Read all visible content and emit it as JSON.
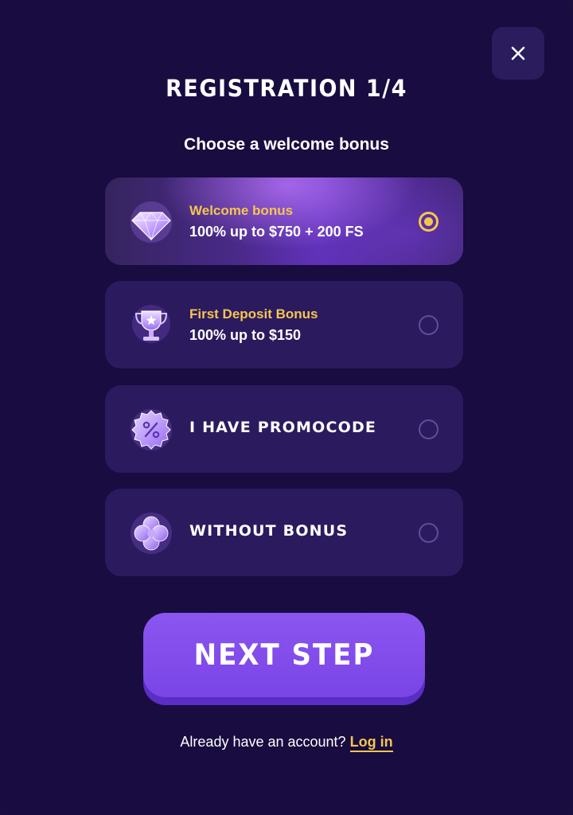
{
  "header": {
    "title": "REGISTRATION 1/4",
    "subtitle": "Choose a welcome bonus",
    "close_icon": "close-icon"
  },
  "options": [
    {
      "label": "Welcome bonus",
      "value": "100% up to $750 + 200 FS",
      "icon": "diamond-icon",
      "selected": true
    },
    {
      "label": "First Deposit Bonus",
      "value": "100% up to $150",
      "icon": "trophy-icon",
      "selected": false
    },
    {
      "label": "I HAVE PROMOCODE",
      "icon": "percent-badge-icon",
      "selected": false
    },
    {
      "label": "WITHOUT BONUS",
      "icon": "clover-icon",
      "selected": false
    }
  ],
  "actions": {
    "next_label": "NEXT STEP"
  },
  "footer": {
    "prompt": "Already have an account?",
    "login_label": "Log in"
  },
  "colors": {
    "background": "#180c40",
    "card": "#2c1a5f",
    "accent_gold": "#f4c64e",
    "button_purple": "#7a45e6"
  }
}
